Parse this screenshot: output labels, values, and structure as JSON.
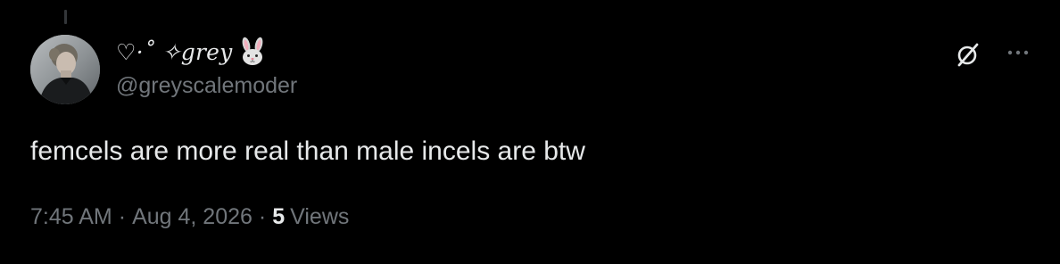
{
  "tweet": {
    "author": {
      "display_name": "♡·˚ ✧grey",
      "display_name_emoji": "rabbit-face",
      "handle": "@greyscalemoder"
    },
    "text": "femcels are more real than male incels are btw",
    "time": "7:45 AM",
    "date": "Aug 4, 2026",
    "separator": "·",
    "views_count": "5",
    "views_label": "Views"
  },
  "icons": {
    "grok": "grok-slash-icon",
    "more": "more-horizontal-icon"
  },
  "colors": {
    "background": "#000000",
    "primary_text": "#e7e9ea",
    "secondary_text": "#71767b",
    "thread_line": "#333639"
  }
}
